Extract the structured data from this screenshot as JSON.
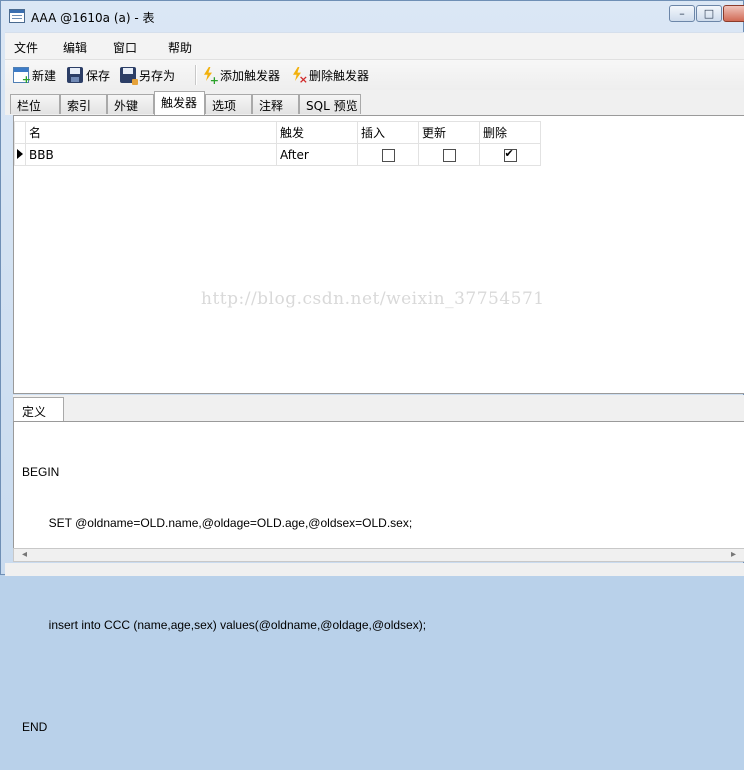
{
  "window": {
    "title": "AAA @1610a (a) - 表"
  },
  "menu": {
    "items": [
      "文件",
      "编辑",
      "窗口",
      "帮助"
    ]
  },
  "toolbar": {
    "new_label": "新建",
    "save_label": "保存",
    "saveas_label": "另存为",
    "add_trigger_label": "添加触发器",
    "delete_trigger_label": "删除触发器"
  },
  "tabs": {
    "items": [
      "栏位",
      "索引",
      "外键",
      "触发器",
      "选项",
      "注释",
      "SQL 预览"
    ],
    "active": "触发器"
  },
  "grid": {
    "columns": [
      "名",
      "触发",
      "插入",
      "更新",
      "删除"
    ],
    "rows": [
      {
        "name": "BBB",
        "fire": "After",
        "insert": false,
        "update": false,
        "delete": true
      }
    ]
  },
  "watermark": "http://blog.csdn.net/weixin_37754571",
  "definition": {
    "tab_label": "定义",
    "lines": [
      "BEGIN",
      "        SET @oldname=OLD.name,@oldage=OLD.age,@oldsex=OLD.sex;",
      "",
      "        insert into CCC (name,age,sex) values(@oldname,@oldage,@oldsex);",
      "",
      "END"
    ]
  },
  "icons": {
    "app": "table-icon",
    "new": "new-table-icon",
    "save": "save-disk-icon",
    "saveas": "save-as-icon",
    "add_trigger": "add-trigger-icon",
    "delete_trigger": "delete-trigger-icon"
  }
}
